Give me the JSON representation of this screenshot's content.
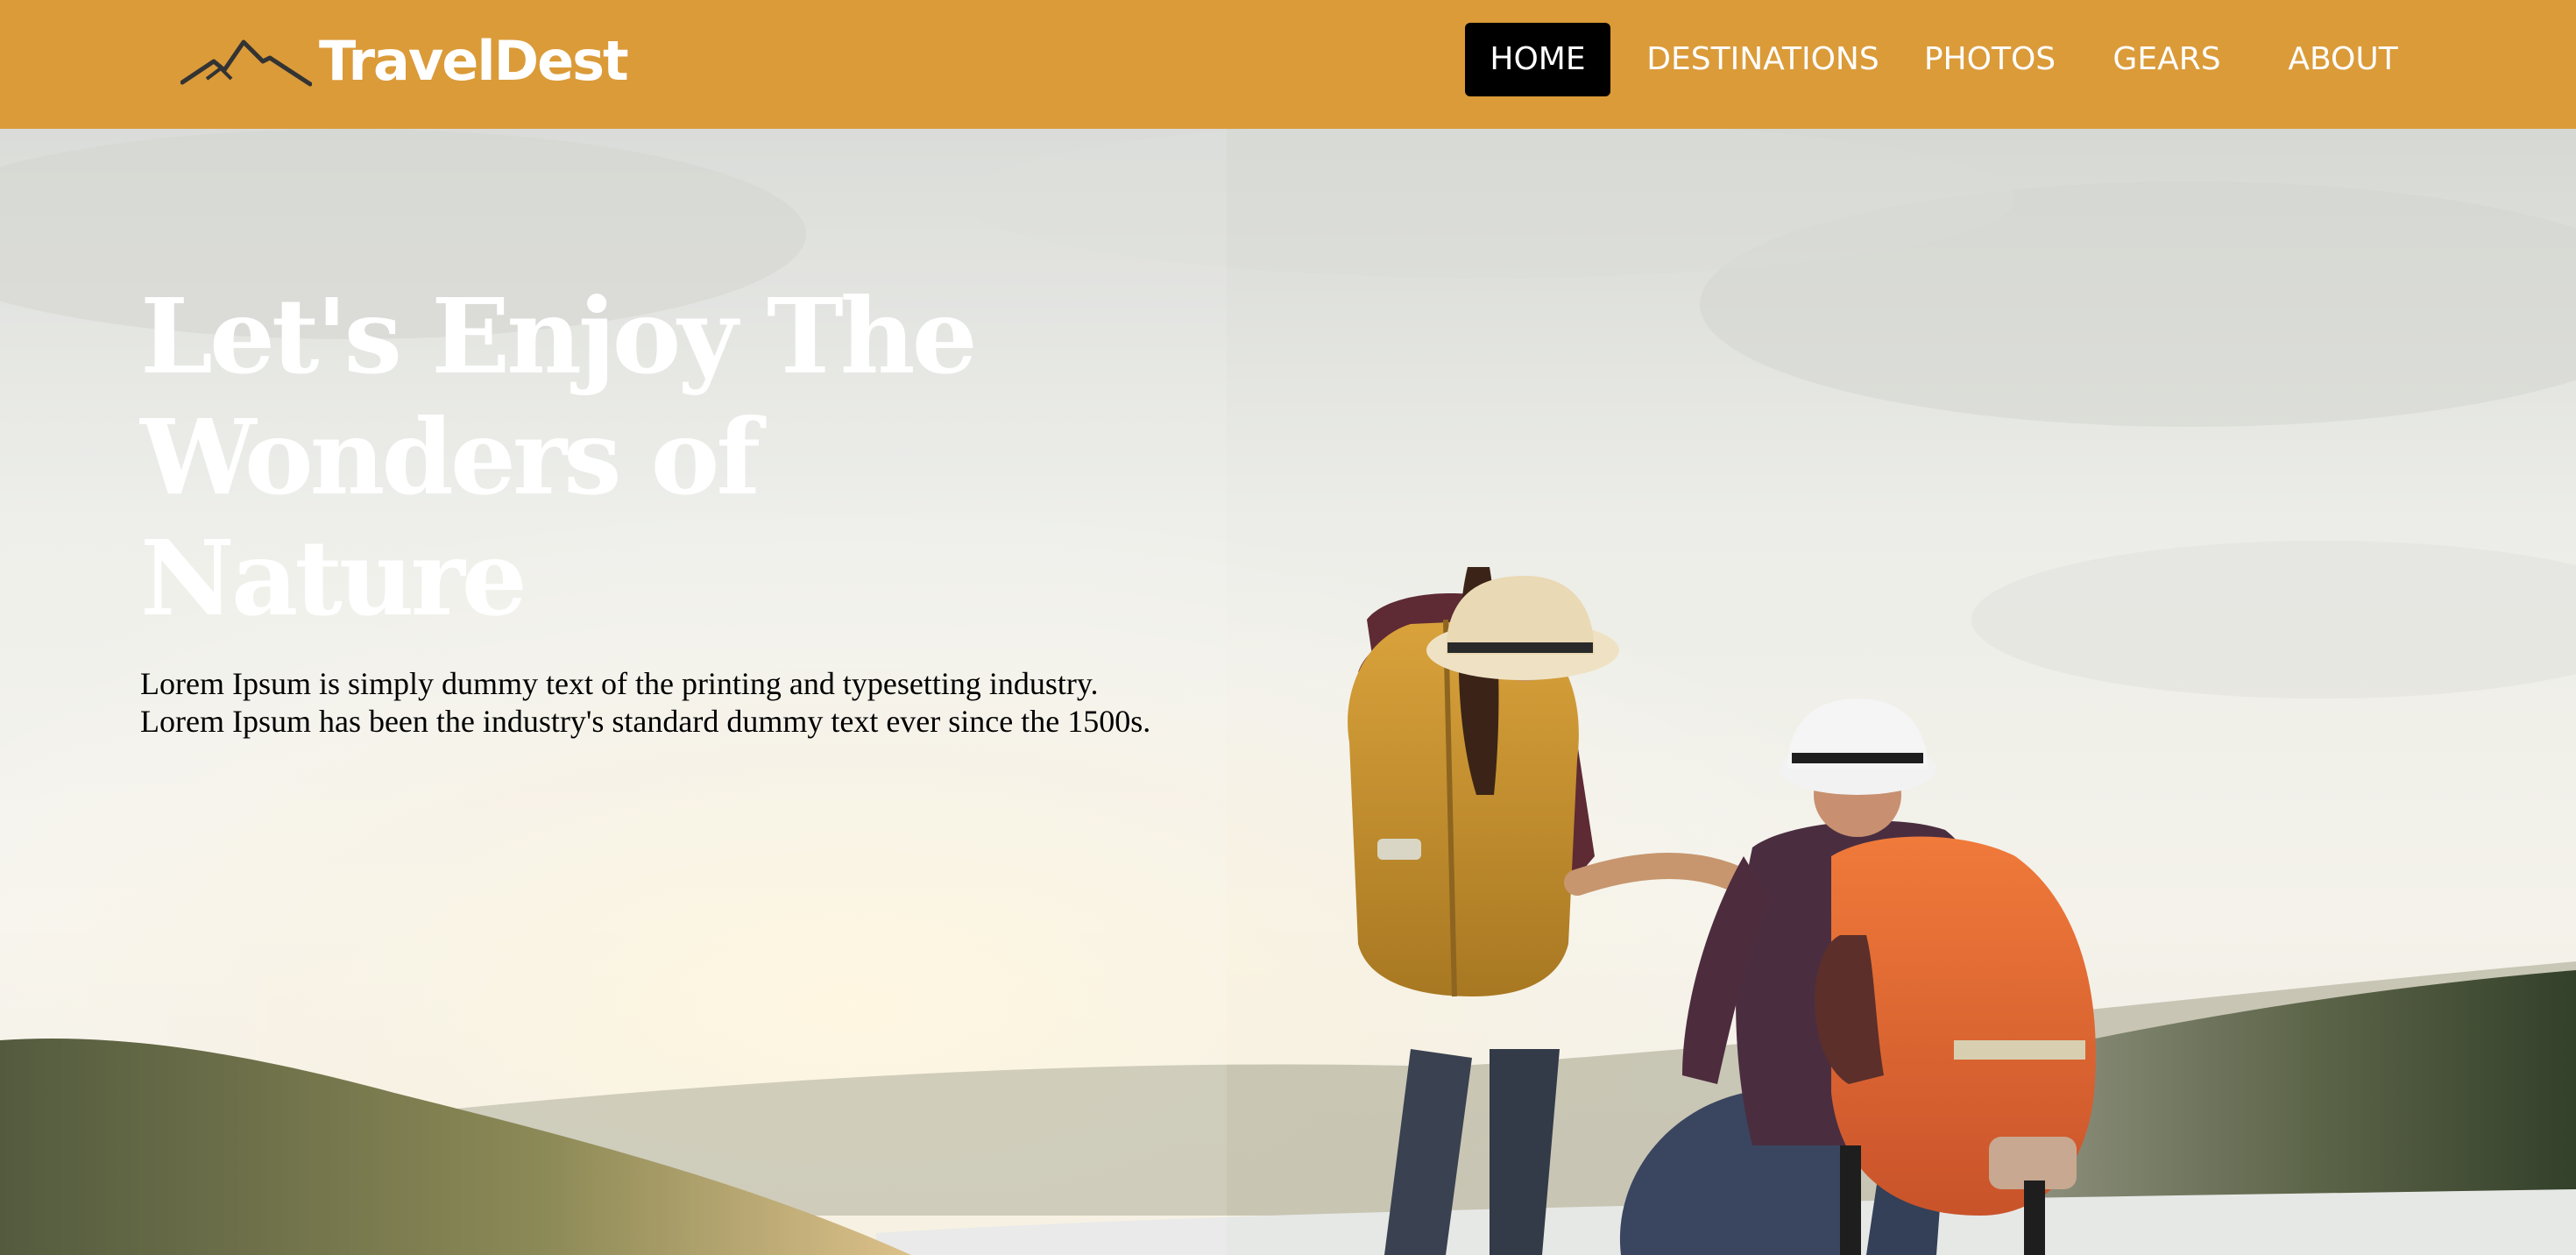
{
  "brand": {
    "name": "TravelDest",
    "logo_icon": "mountain-icon"
  },
  "nav": {
    "items": [
      {
        "label": "HOME",
        "active": true
      },
      {
        "label": "DESTINATIONS",
        "active": false
      },
      {
        "label": "PHOTOS",
        "active": false
      },
      {
        "label": "GEARS",
        "active": false
      },
      {
        "label": "ABOUT",
        "active": false
      }
    ]
  },
  "hero": {
    "title": "Let's Enjoy The Wonders of Nature",
    "lines": [
      "Lorem Ipsum is simply dummy text of the printing and typesetting industry.",
      "Lorem Ipsum has been the industry's standard dummy text ever since the 1500s."
    ]
  },
  "colors": {
    "navbar_bg": "#DB9B39",
    "active_tab_bg": "#000000",
    "nav_text": "#FFFFFF"
  }
}
